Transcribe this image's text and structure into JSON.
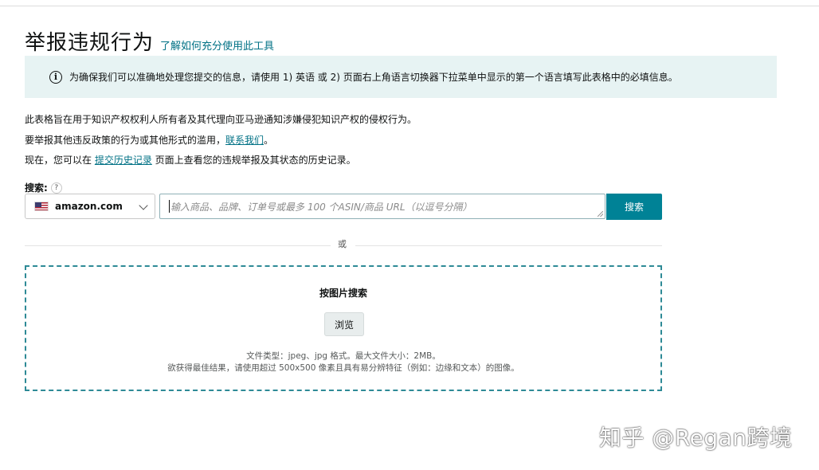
{
  "header": {
    "title": "举报违规行为",
    "help_link": "了解如何充分使用此工具"
  },
  "banner": {
    "icon": "info-icon",
    "text": "为确保我们可以准确地处理您提交的信息，请使用 1) 英语 或 2) 页面右上角语言切换器下拉菜单中显示的第一个语言填写此表格中的必填信息。"
  },
  "description": {
    "line1": "此表格旨在用于知识产权权利人所有者及其代理向亚马逊通知涉嫌侵犯知识产权的侵权行为。",
    "line2_prefix": "要举报其他违反政策的行为或其他形式的滥用，",
    "line2_link": "联系我们",
    "line2_suffix": "。",
    "line3_prefix": "现在，您可以在 ",
    "line3_link": "提交历史记录",
    "line3_suffix": " 页面上查看您的违规举报及其状态的历史记录。"
  },
  "search": {
    "label": "搜索:",
    "help_icon_text": "?",
    "marketplace": "amazon.com",
    "placeholder": "输入商品、品牌、订单号或最多 100 个ASIN/商品 URL（以逗号分隔）",
    "button": "搜索"
  },
  "divider": {
    "text": "或"
  },
  "image_search": {
    "title": "按图片搜索",
    "browse": "浏览",
    "hint1": "文件类型：jpeg、jpg 格式。最大文件大小：2MB。",
    "hint2": "欲获得最佳结果，请使用超过 500x500 像素且具有易分辨特征（例如：边缘和文本）的图像。"
  },
  "watermark": "知乎 @Regan跨境",
  "colors": {
    "accent": "#008296",
    "link": "#007185",
    "banner_bg": "#e7f3f3",
    "dropzone_border": "#2e8a96"
  }
}
